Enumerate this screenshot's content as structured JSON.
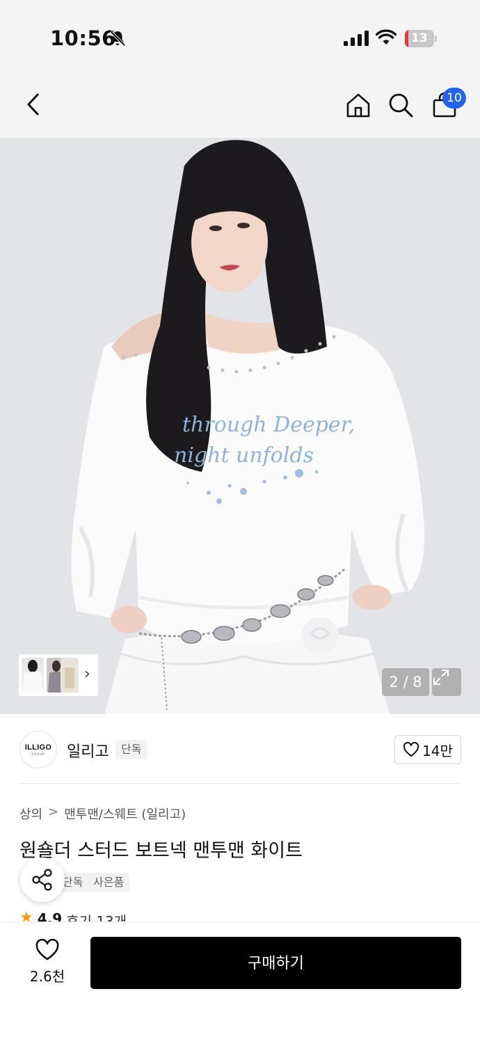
{
  "status_bar": {
    "time": "10:56",
    "battery_level": "13",
    "battery_fraction": 0.13,
    "icons": [
      "bell-slash-icon",
      "cellular-signal-icon",
      "wifi-icon",
      "battery-icon"
    ]
  },
  "nav": {
    "icons": [
      "back-chevron-icon",
      "home-icon",
      "search-icon",
      "shopping-bag-icon"
    ],
    "cart_count": "10",
    "badge_color": "#2563eb"
  },
  "gallery": {
    "counter": "2 / 8",
    "thumbnail_count_visible": 3,
    "expand_icon": "expand-arrows-icon",
    "print_text_line1": "through Deeper,",
    "print_text_line2": "night unfolds"
  },
  "brand": {
    "logo_text": "ILLIGO",
    "logo_subtext": "GROUP",
    "name": "일리고",
    "tag": "단독",
    "like_count": "14만"
  },
  "product": {
    "breadcrumb": [
      "상의",
      "맨투맨/스웨트 (일리고)"
    ],
    "breadcrumb_separator": ">",
    "title": "원숄더 스터드 보트넥 맨투맨 화이트",
    "tags": [
      "단독",
      "사은품"
    ],
    "rating": "4.9",
    "review_label": "후기 13개"
  },
  "bottom": {
    "wish_count": "2.6천",
    "buy_label": "구매하기"
  },
  "colors": {
    "accent": "#2563eb",
    "star": "#f59e0b",
    "buy_button": "#000000",
    "battery_low": "#e53935"
  }
}
